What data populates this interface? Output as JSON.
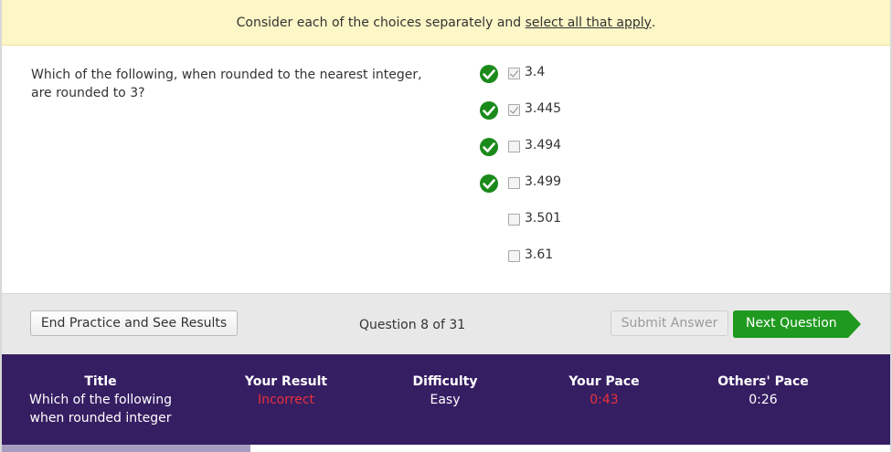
{
  "instruction": {
    "prefix": "Consider each of the choices separately and ",
    "link": "select all that apply",
    "suffix": "."
  },
  "question": {
    "text": "Which of the following, when rounded to the nearest integer, are rounded to 3?"
  },
  "choices": [
    {
      "label": "3.4",
      "checked": true,
      "correct_mark": true
    },
    {
      "label": "3.445",
      "checked": true,
      "correct_mark": true
    },
    {
      "label": "3.494",
      "checked": false,
      "correct_mark": true
    },
    {
      "label": "3.499",
      "checked": false,
      "correct_mark": true
    },
    {
      "label": "3.501",
      "checked": false,
      "correct_mark": false
    },
    {
      "label": "3.61",
      "checked": false,
      "correct_mark": false
    }
  ],
  "actions": {
    "end_practice": "End Practice and See Results",
    "counter": "Question 8 of 31",
    "submit": "Submit Answer",
    "next": "Next Question"
  },
  "stats": {
    "title_head": "Title",
    "title_line1": "Which of the following",
    "title_line2": "when rounded integer",
    "result_head": "Your Result",
    "result_val": "Incorrect",
    "difficulty_head": "Difficulty",
    "difficulty_val": "Easy",
    "pace_head": "Your Pace",
    "pace_val": "0:43",
    "others_head": "Others' Pace",
    "others_val": "0:26"
  },
  "progress": {
    "fraction": 0.28
  },
  "colors": {
    "instruction_bg": "#fdf6c6",
    "check_green": "#1b8a1b",
    "next_button_green": "#1f9a1f",
    "stats_bg": "#361e62",
    "incorrect_red": "#e8323c",
    "progress_fill": "#a89bc0"
  },
  "icons": {
    "correct_mark": "check-circle-icon",
    "next_arrow": "arrow-right-icon"
  }
}
